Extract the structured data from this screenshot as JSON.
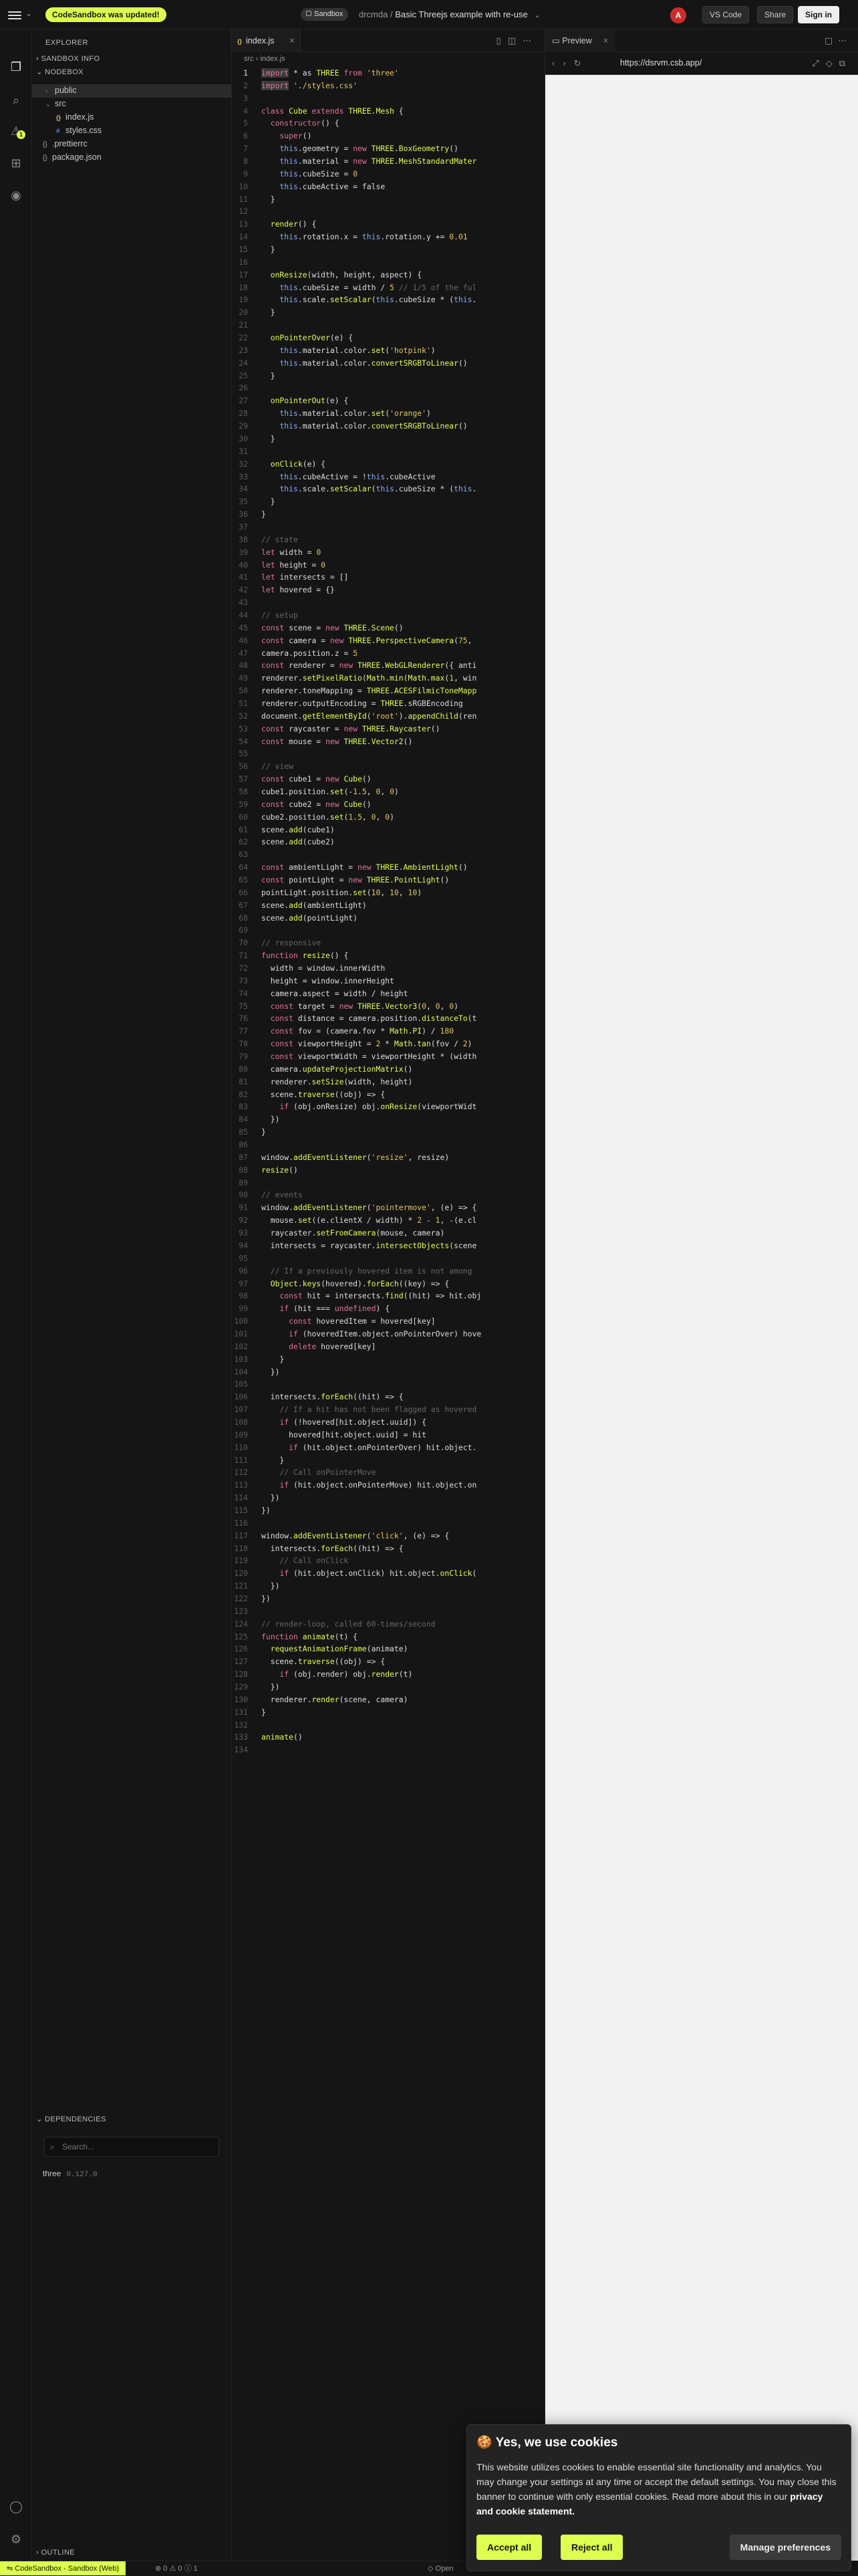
{
  "topbar": {
    "update_notice": "CodeSandbox was updated!",
    "sandbox_badge": "Sandbox",
    "owner": "drcmda",
    "separator": "/",
    "title": "Basic Threejs example with re-use",
    "avatar_letter": "A",
    "vscode_label": "VS Code",
    "share_label": "Share",
    "signin_label": "Sign in",
    "accent_color": "#dcff50"
  },
  "activity": {
    "problems_badge": "1"
  },
  "sidebar": {
    "explorer_title": "EXPLORER",
    "sandbox_info": "SANDBOX INFO",
    "nodebox": "NODEBOX",
    "tree": [
      {
        "label": "public",
        "type": "folder"
      },
      {
        "label": "src",
        "type": "folder-open"
      },
      {
        "label": "index.js",
        "type": "js"
      },
      {
        "label": "styles.css",
        "type": "css"
      },
      {
        "label": ".prettierrc",
        "type": "config"
      },
      {
        "label": "package.json",
        "type": "config"
      }
    ],
    "dependencies_title": "DEPENDENCIES",
    "search_placeholder": "Search...",
    "dependency": {
      "name": "three",
      "version": "0.127.0"
    },
    "outline_title": "OUTLINE"
  },
  "editor": {
    "tab_label": "index.js",
    "breadcrumb_folder": "src",
    "breadcrumb_file": "index.js",
    "lines": [
      "import * as THREE from 'three'",
      "import './styles.css'",
      "",
      "class Cube extends THREE.Mesh {",
      "  constructor() {",
      "    super()",
      "    this.geometry = new THREE.BoxGeometry()",
      "    this.material = new THREE.MeshStandardMater",
      "    this.cubeSize = 0",
      "    this.cubeActive = false",
      "  }",
      "",
      "  render() {",
      "    this.rotation.x = this.rotation.y += 0.01",
      "  }",
      "",
      "  onResize(width, height, aspect) {",
      "    this.cubeSize = width / 5 // 1/5 of the ful",
      "    this.scale.setScalar(this.cubeSize * (this.",
      "  }",
      "",
      "  onPointerOver(e) {",
      "    this.material.color.set('hotpink')",
      "    this.material.color.convertSRGBToLinear()",
      "  }",
      "",
      "  onPointerOut(e) {",
      "    this.material.color.set('orange')",
      "    this.material.color.convertSRGBToLinear()",
      "  }",
      "",
      "  onClick(e) {",
      "    this.cubeActive = !this.cubeActive",
      "    this.scale.setScalar(this.cubeSize * (this.",
      "  }",
      "}",
      "",
      "// state",
      "let width = 0",
      "let height = 0",
      "let intersects = []",
      "let hovered = {}",
      "",
      "// setup",
      "const scene = new THREE.Scene()",
      "const camera = new THREE.PerspectiveCamera(75, ",
      "camera.position.z = 5",
      "const renderer = new THREE.WebGLRenderer({ anti",
      "renderer.setPixelRatio(Math.min(Math.max(1, win",
      "renderer.toneMapping = THREE.ACESFilmicToneMapp",
      "renderer.outputEncoding = THREE.sRGBEncoding",
      "document.getElementById('root').appendChild(ren",
      "const raycaster = new THREE.Raycaster()",
      "const mouse = new THREE.Vector2()",
      "",
      "// view",
      "const cube1 = new Cube()",
      "cube1.position.set(-1.5, 0, 0)",
      "const cube2 = new Cube()",
      "cube2.position.set(1.5, 0, 0)",
      "scene.add(cube1)",
      "scene.add(cube2)",
      "",
      "const ambientLight = new THREE.AmbientLight()",
      "const pointLight = new THREE.PointLight()",
      "pointLight.position.set(10, 10, 10)",
      "scene.add(ambientLight)",
      "scene.add(pointLight)",
      "",
      "// responsive",
      "function resize() {",
      "  width = window.innerWidth",
      "  height = window.innerHeight",
      "  camera.aspect = width / height",
      "  const target = new THREE.Vector3(0, 0, 0)",
      "  const distance = camera.position.distanceTo(t",
      "  const fov = (camera.fov * Math.PI) / 180",
      "  const viewportHeight = 2 * Math.tan(fov / 2)",
      "  const viewportWidth = viewportHeight * (width",
      "  camera.updateProjectionMatrix()",
      "  renderer.setSize(width, height)",
      "  scene.traverse((obj) => {",
      "    if (obj.onResize) obj.onResize(viewportWidt",
      "  })",
      "}",
      "",
      "window.addEventListener('resize', resize)",
      "resize()",
      "",
      "// events",
      "window.addEventListener('pointermove', (e) => {",
      "  mouse.set((e.clientX / width) * 2 - 1, -(e.cl",
      "  raycaster.setFromCamera(mouse, camera)",
      "  intersects = raycaster.intersectObjects(scene",
      "",
      "  // If a previously hovered item is not among ",
      "  Object.keys(hovered).forEach((key) => {",
      "    const hit = intersects.find((hit) => hit.obj",
      "    if (hit === undefined) {",
      "      const hoveredItem = hovered[key]",
      "      if (hoveredItem.object.onPointerOver) hove",
      "      delete hovered[key]",
      "    }",
      "  })",
      "",
      "  intersects.forEach((hit) => {",
      "    // If a hit has not been flagged as hovered",
      "    if (!hovered[hit.object.uuid]) {",
      "      hovered[hit.object.uuid] = hit",
      "      if (hit.object.onPointerOver) hit.object.",
      "    }",
      "    // Call onPointerMove",
      "    if (hit.object.onPointerMove) hit.object.on",
      "  })",
      "})",
      "",
      "window.addEventListener('click', (e) => {",
      "  intersects.forEach((hit) => {",
      "    // Call onClick",
      "    if (hit.object.onClick) hit.object.onClick(",
      "  })",
      "})",
      "",
      "// render-loop, called 60-times/second",
      "function animate(t) {",
      "  requestAnimationFrame(animate)",
      "  scene.traverse((obj) => {",
      "    if (obj.render) obj.render(t)",
      "  })",
      "  renderer.render(scene, camera)",
      "}",
      "",
      "animate()",
      ""
    ]
  },
  "preview": {
    "tab_label": "Preview",
    "url": "https://dsrvm.csb.app/"
  },
  "statusbar": {
    "left_label": "CodeSandbox - Sandbox (Web)",
    "errors": "0",
    "warnings": "0",
    "info": "1",
    "open_label": "Open"
  },
  "cookie": {
    "title": "Yes, we use cookies",
    "body": "This website utilizes cookies to enable essential site functionality and analytics. You may change your settings at any time or accept the default settings. You may close this banner to continue with only essential cookies. Read more about this in our",
    "link_text": "privacy and cookie statement.",
    "accept_label": "Accept all",
    "reject_label": "Reject all",
    "prefs_label": "Manage preferences"
  }
}
